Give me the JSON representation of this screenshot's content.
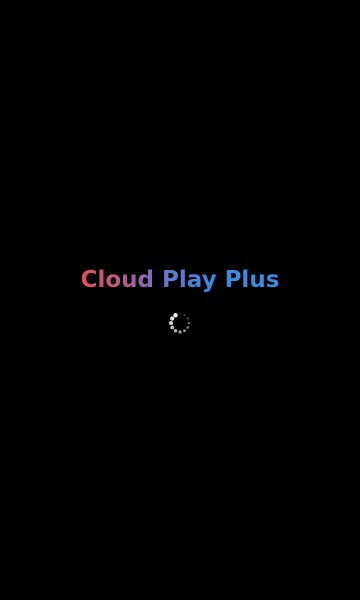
{
  "splash": {
    "title": "Cloud Play Plus",
    "loading_indicator": "spinner-icon"
  },
  "colors": {
    "background": "#000000",
    "title_gradient_start": "#e8505b",
    "title_gradient_end": "#3a8ee6",
    "spinner": "#ffffff"
  }
}
